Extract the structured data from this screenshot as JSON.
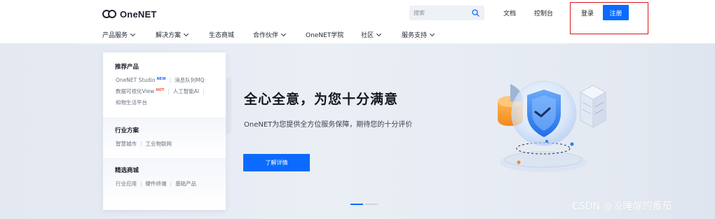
{
  "brand": {
    "logo_text": "OneNET"
  },
  "header": {
    "search_placeholder": "搜索",
    "links": [
      "文档",
      "控制台"
    ],
    "login_label": "登录",
    "register_label": "注册"
  },
  "nav": {
    "items": [
      {
        "label": "产品服务",
        "dropdown": true
      },
      {
        "label": "解决方案",
        "dropdown": true
      },
      {
        "label": "生态商城",
        "dropdown": false
      },
      {
        "label": "合作伙伴",
        "dropdown": true
      },
      {
        "label": "OneNET学院",
        "dropdown": false
      },
      {
        "label": "社区",
        "dropdown": true
      },
      {
        "label": "服务支持",
        "dropdown": true
      }
    ]
  },
  "menu": {
    "recommended": {
      "title": "推荐产品",
      "row1": {
        "a": "OneNET Studio",
        "a_badge": "NEW",
        "b": "消息队列MQ"
      },
      "row2": {
        "a": "数据可视化View",
        "a_badge": "HOT",
        "b": "人工智能AI"
      },
      "row3": "和物生活平台"
    },
    "industry": {
      "title": "行业方案",
      "items": [
        "智慧城市",
        "工业物联网"
      ]
    },
    "mall": {
      "title": "精选商城",
      "items": [
        "行业应用",
        "硬件终端",
        "基础产品"
      ]
    }
  },
  "hero": {
    "title": "全心全意，为您十分满意",
    "subtitle": "OneNET为您提供全方位服务保障，期待您的十分评价",
    "button_label": "了解详情",
    "carousel": {
      "count": 2,
      "active": 0
    }
  },
  "colors": {
    "accent": "#0b6bff",
    "highlight_box": "#d9171c"
  },
  "watermark": "CSDN @没睡醒的番茄"
}
